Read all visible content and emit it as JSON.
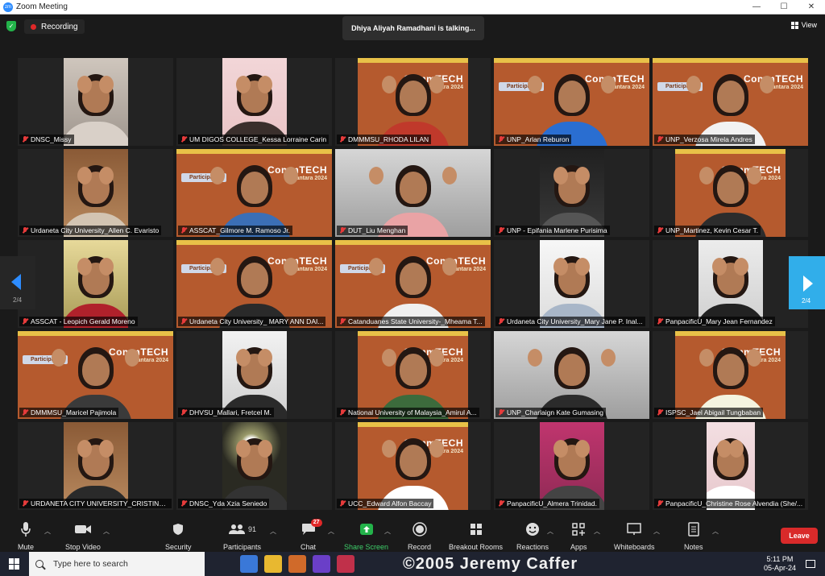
{
  "window": {
    "title": "Zoom Meeting",
    "minimize": "—",
    "maximize": "☐",
    "close": "✕"
  },
  "top": {
    "recording_label": "Recording",
    "talking": "Dhiya Aliyah Ramadhani is talking...",
    "view_label": "View"
  },
  "banner": {
    "title_line1": "CommTECH",
    "title_line2": "Nusantara 2024",
    "participant": "Participant"
  },
  "colors": {
    "accent": "#2d8cff",
    "leave": "#d92a2a",
    "record": "#e02828",
    "banner_bg": "#b55a2e",
    "banner_strip": "#e8c148"
  },
  "participants": [
    {
      "name": "DNSC_Missy",
      "style": "room",
      "shirt": "#d9d0c8"
    },
    {
      "name": "UM DIGOS COLLEGE_Kessa Lorraine Carin",
      "style": "pink",
      "shirt": "#3a2f2c"
    },
    {
      "name": "DMMMSU_RHODA LILAN",
      "style": "banner",
      "shirt": "#c0392b"
    },
    {
      "name": "UNP_Arlan Reburon",
      "style": "banner-p",
      "shirt": "#2a6ed1"
    },
    {
      "name": "UNP_Verzosa Mirela Andres",
      "style": "banner-p",
      "shirt": "#f2f2f2"
    },
    {
      "name": "Urdaneta City University_Allen C. Evaristo",
      "style": "wood",
      "shirt": "#d3c4b2"
    },
    {
      "name": "ASSCAT_Gilmore M. Ramoso Jr.",
      "style": "banner-p",
      "shirt": "#3b6fb6"
    },
    {
      "name": "DUT_Liu Menghan",
      "style": "grey",
      "shirt": "#e9a3a5"
    },
    {
      "name": "UNP - Epifania Marlene Purisima",
      "style": "dark",
      "shirt": "#555555"
    },
    {
      "name": "UNP_Martinez, Kevin Cesar T.",
      "style": "banner",
      "shirt": "#2c2c2c"
    },
    {
      "name": "ASSCAT - Leopich Gerald Moreno",
      "style": "yellow",
      "shirt": "#b0212b"
    },
    {
      "name": "Urdaneta City University_ MARY ANN DAI...",
      "style": "banner-p",
      "shirt": "#2a2a2a"
    },
    {
      "name": "Catanduanes State University-_Mheama T...",
      "style": "banner-p",
      "shirt": "#f0f0f0"
    },
    {
      "name": "Urdaneta City University_Mary Jane P. Inal...",
      "style": "white",
      "shirt": "#a8b6c8"
    },
    {
      "name": "PanpacificU_Mary Jean Fernandez",
      "style": "whitewall",
      "shirt": "#222222"
    },
    {
      "name": "DMMMSU_Maricel Pajimola",
      "style": "banner-p",
      "shirt": "#3a3a3a"
    },
    {
      "name": "DHVSU_Mallari, Fretcel M.",
      "style": "ceiling",
      "shirt": "#2a2a2a"
    },
    {
      "name": "National University of Malaysia_Amirul A...",
      "style": "banner",
      "shirt": "#3c6b3c"
    },
    {
      "name": "UNP_Charlaign Kate Gumasing",
      "style": "grey",
      "shirt": "#2b2b2b"
    },
    {
      "name": "ISPSC_Jael Abigail Tungbaban",
      "style": "banner",
      "shirt": "#f4f4e0"
    },
    {
      "name": "URDANETA CITY UNIVERSITY_CRISTINA ...",
      "style": "wood",
      "shirt": "#2a2a2a"
    },
    {
      "name": "DNSC_Yda Xzia Seniedo",
      "style": "dark-light",
      "shirt": "#333333"
    },
    {
      "name": "UCC_Edward Alfon Baccay",
      "style": "banner",
      "shirt": "#ffffff"
    },
    {
      "name": "PanpacificU_Almera Trinidad.",
      "style": "magenta",
      "shirt": "#444444"
    },
    {
      "name": "PanpacificU_Christine Rose Alvendia (She/...",
      "style": "pinkwall",
      "shirt": "#ffffff"
    }
  ],
  "pager": {
    "left": "2/4",
    "right": "2/4"
  },
  "toolbar": {
    "mute": "Mute",
    "stop_video": "Stop Video",
    "security": "Security",
    "participants": "Participants",
    "participants_count": "91",
    "chat": "Chat",
    "chat_badge": "27",
    "share_screen": "Share Screen",
    "record": "Record",
    "breakout": "Breakout Rooms",
    "reactions": "Reactions",
    "apps": "Apps",
    "whiteboards": "Whiteboards",
    "notes": "Notes",
    "leave": "Leave"
  },
  "taskbar": {
    "search_placeholder": "Type here to search",
    "watermark": "©2005 Jeremy Caffer",
    "time": "5:11 PM",
    "date": "05-Apr-24"
  }
}
